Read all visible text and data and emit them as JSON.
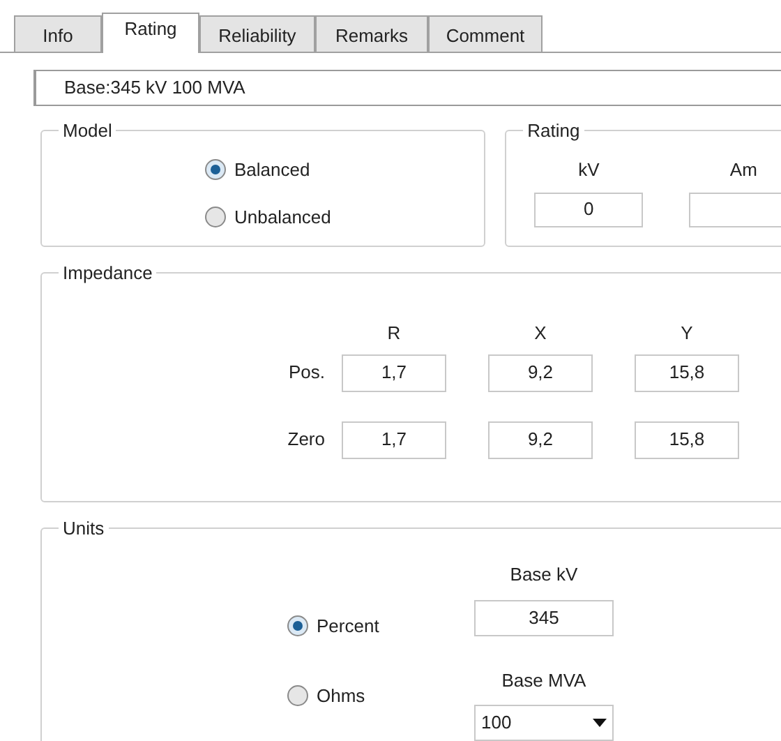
{
  "tabs": [
    {
      "label": "Info",
      "selected": false
    },
    {
      "label": "Rating",
      "selected": true
    },
    {
      "label": "Reliability",
      "selected": false
    },
    {
      "label": "Remarks",
      "selected": false
    },
    {
      "label": "Comment",
      "selected": false
    }
  ],
  "base_info": "Base:345 kV 100 MVA",
  "model": {
    "title": "Model",
    "options": [
      {
        "label": "Balanced",
        "selected": true
      },
      {
        "label": "Unbalanced",
        "selected": false
      }
    ]
  },
  "rating": {
    "title": "Rating",
    "columns": [
      {
        "label": "kV",
        "value": "0"
      },
      {
        "label": "Am"
      }
    ]
  },
  "impedance": {
    "title": "Impedance",
    "columns": [
      "R",
      "X",
      "Y"
    ],
    "rows": [
      {
        "label": "Pos.",
        "values": [
          "1,7",
          "9,2",
          "15,8"
        ]
      },
      {
        "label": "Zero",
        "values": [
          "1,7",
          "9,2",
          "15,8"
        ]
      }
    ]
  },
  "units": {
    "title": "Units",
    "options": [
      {
        "label": "Percent",
        "selected": true
      },
      {
        "label": "Ohms",
        "selected": false
      }
    ],
    "base_kv": {
      "label": "Base kV",
      "value": "345"
    },
    "base_mva": {
      "label": "Base MVA",
      "value": "100"
    }
  }
}
